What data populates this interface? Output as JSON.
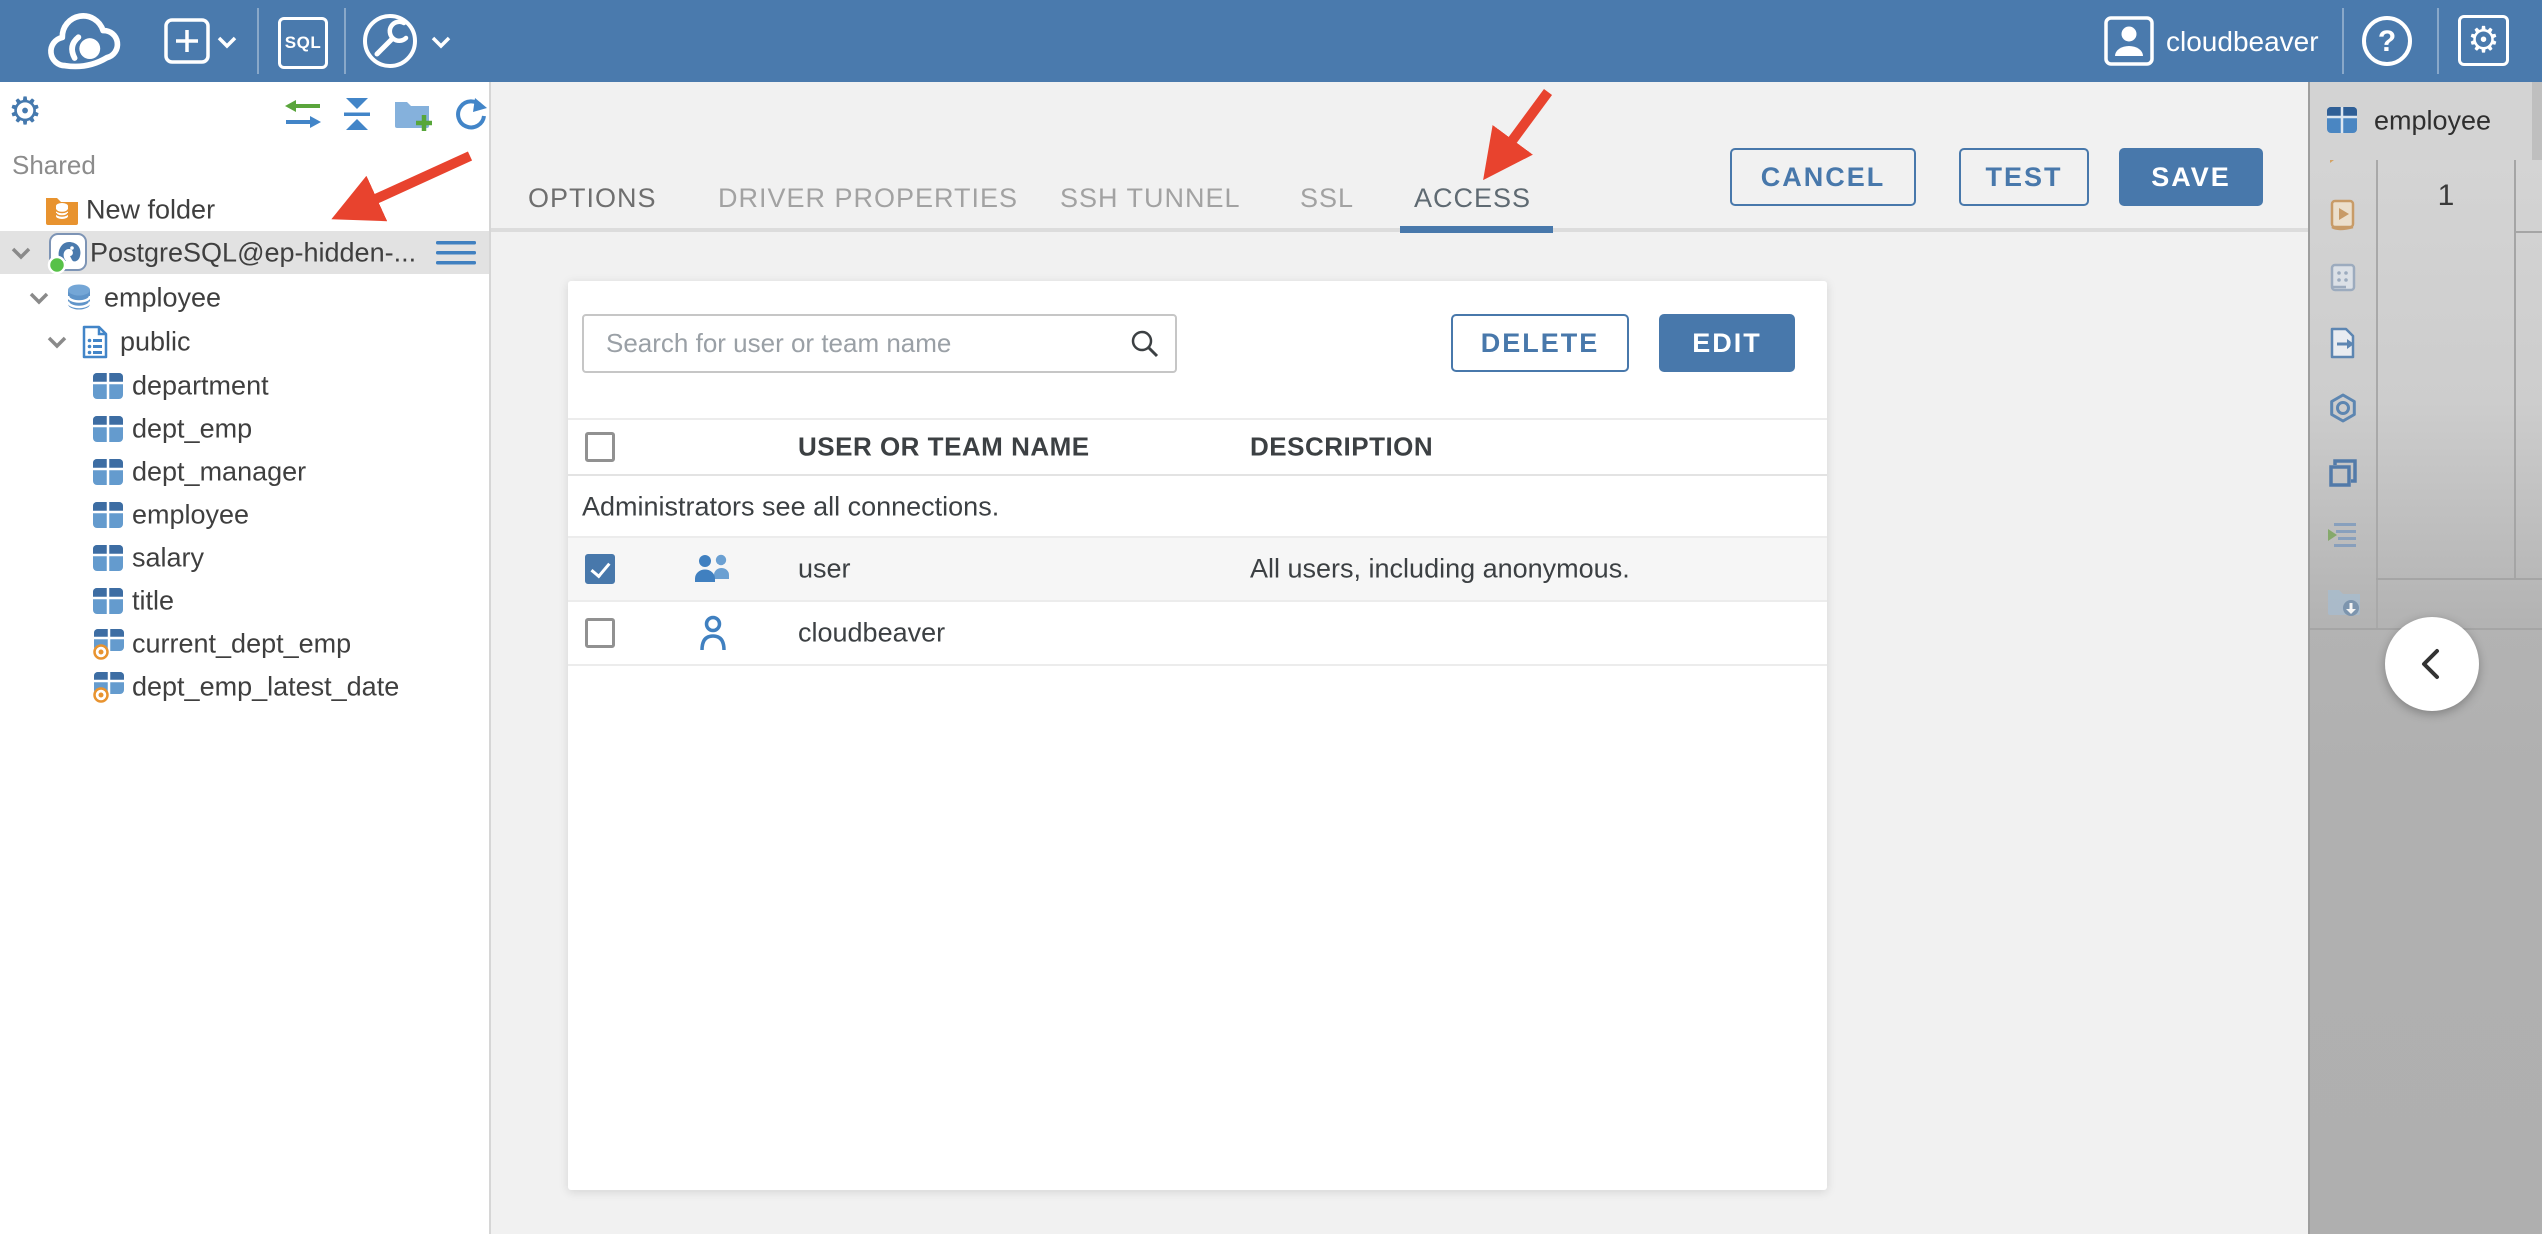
{
  "topbar": {
    "sql_label": "SQL",
    "user_label": "cloudbeaver",
    "help_glyph": "?",
    "gear_glyph": "⚙"
  },
  "sidebar": {
    "gear_glyph": "⚙",
    "section_label": "Shared",
    "tree": [
      {
        "label": "New folder",
        "type": "folder",
        "indent": 1
      },
      {
        "label": "PostgreSQL@ep-hidden-...",
        "type": "postgres-connection",
        "indent": 0,
        "expanded": true,
        "selected": true,
        "status": "connected"
      },
      {
        "label": "employee",
        "type": "database",
        "indent": 1,
        "expanded": true
      },
      {
        "label": "public",
        "type": "schema",
        "indent": 2,
        "expanded": true
      },
      {
        "label": "department",
        "type": "table",
        "indent": 3
      },
      {
        "label": "dept_emp",
        "type": "table",
        "indent": 3
      },
      {
        "label": "dept_manager",
        "type": "table",
        "indent": 3
      },
      {
        "label": "employee",
        "type": "table",
        "indent": 3
      },
      {
        "label": "salary",
        "type": "table",
        "indent": 3
      },
      {
        "label": "title",
        "type": "table",
        "indent": 3
      },
      {
        "label": "current_dept_emp",
        "type": "view",
        "indent": 3
      },
      {
        "label": "dept_emp_latest_date",
        "type": "view",
        "indent": 3
      }
    ]
  },
  "main": {
    "tabs": [
      {
        "label": "OPTIONS",
        "state": "enabled"
      },
      {
        "label": "DRIVER PROPERTIES",
        "state": "muted"
      },
      {
        "label": "SSH TUNNEL",
        "state": "muted"
      },
      {
        "label": "SSL",
        "state": "muted"
      },
      {
        "label": "ACCESS",
        "state": "active"
      }
    ],
    "buttons": {
      "cancel": "CANCEL",
      "test": "TEST",
      "save": "SAVE"
    }
  },
  "access": {
    "search_placeholder": "Search for user or team name",
    "delete_label": "DELETE",
    "edit_label": "EDIT",
    "columns": [
      "USER OR TEAM NAME",
      "DESCRIPTION"
    ],
    "note": "Administrators see all connections.",
    "rows": [
      {
        "name": "user",
        "description": "All users, including anonymous.",
        "checked": true,
        "icon": "team"
      },
      {
        "name": "cloudbeaver",
        "description": "",
        "checked": false,
        "icon": "user"
      }
    ]
  },
  "right_panel": {
    "tab_label": "employee",
    "row_number": "1",
    "toolbar_icons": [
      "new-script-icon",
      "execute-script-icon",
      "grid-view-icon",
      "export-data-icon",
      "ai-assistant-icon",
      "frame-icon",
      "output-log-icon",
      "save-to-folder-icon"
    ]
  },
  "colors": {
    "accent": "#4878ab",
    "topbar_bg": "#4a7aad",
    "annotation_arrow": "#e8432e",
    "status_connected": "#57c148",
    "selection_bg": "#e2e2e2"
  }
}
